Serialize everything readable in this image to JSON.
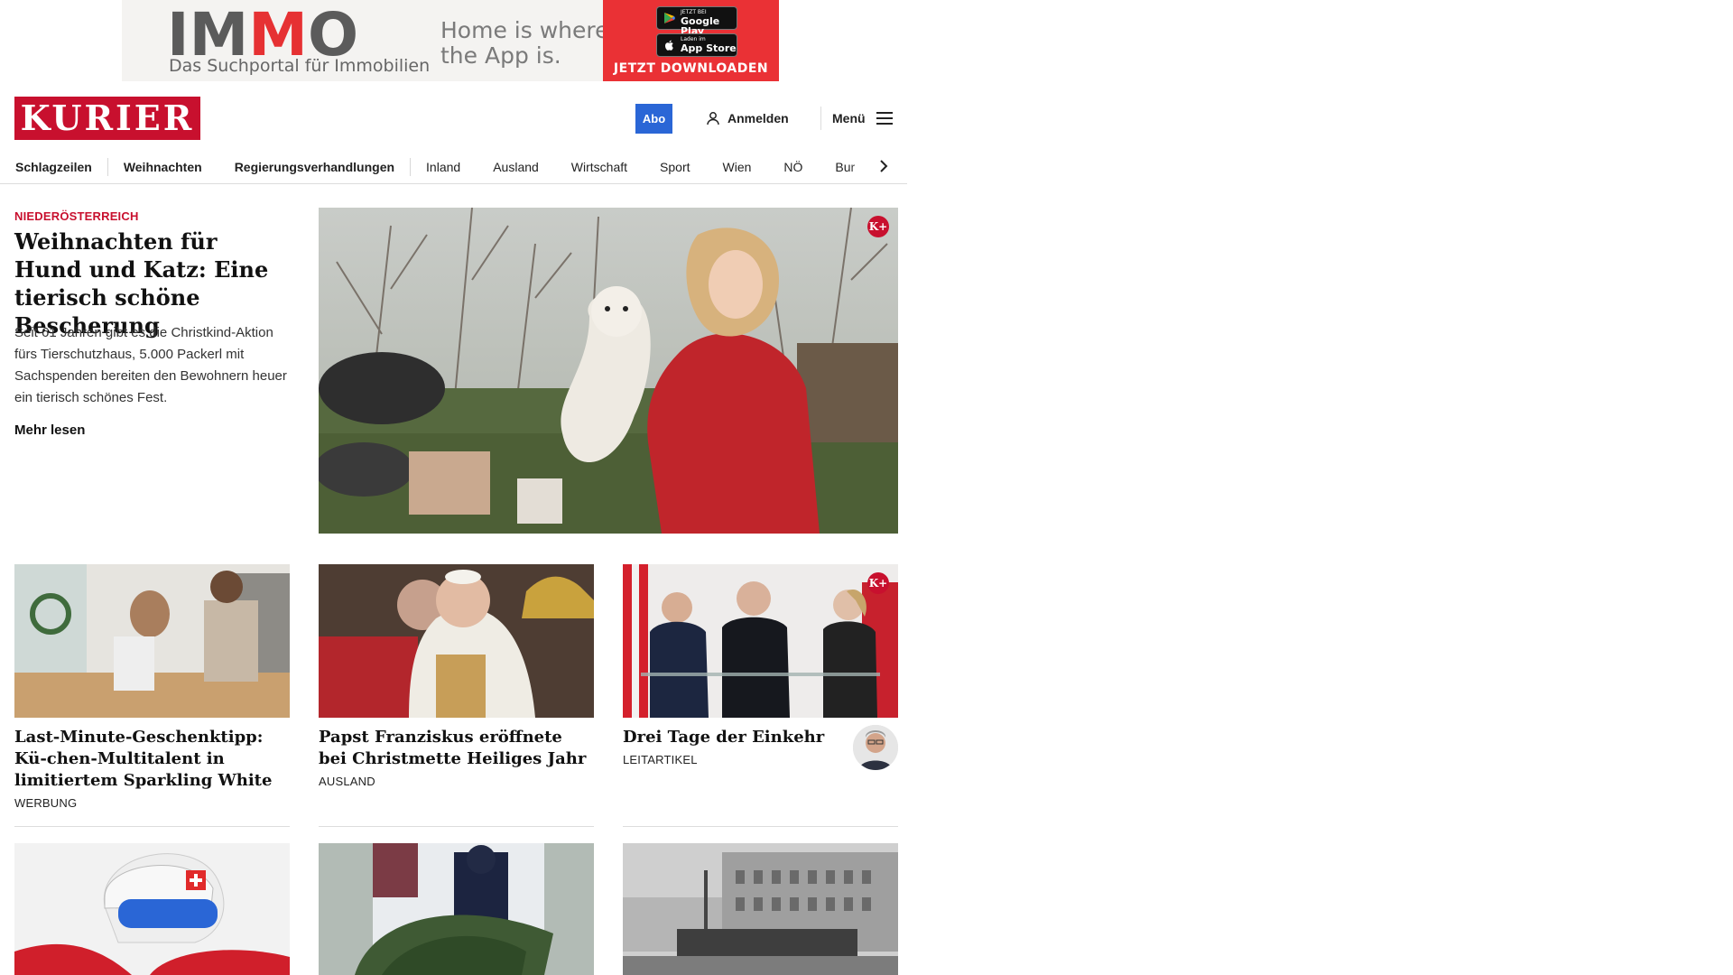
{
  "ad": {
    "brand_pre": "I",
    "brand_m1": "M",
    "brand_m2": "M",
    "brand_post": "O",
    "subline": "Das Suchportal für Immobilien",
    "slogan_line1": "Home is where",
    "slogan_line2": "the App is.",
    "google_small": "JETZT BEI",
    "google_big": "Google Play",
    "apple_small": "Laden im",
    "apple_big": "App Store",
    "cta": "JETZT DOWNLOADEN",
    "colors": {
      "brand_red": "#e63133",
      "brand_grey": "#5b5b5b"
    }
  },
  "header": {
    "logo": "KURIER",
    "abo": "Abo",
    "login": "Anmelden",
    "menu": "Menü",
    "icons": {
      "login": "user-icon",
      "menu": "hamburger-icon"
    },
    "colors": {
      "logo_bg": "#c8102e",
      "abo_bg": "#2a66d6"
    }
  },
  "nav": {
    "items": [
      "Schlagzeilen",
      "Weihnachten",
      "Regierungsverhandlungen",
      "Inland",
      "Ausland",
      "Wirtschaft",
      "Sport",
      "Wien",
      "NÖ",
      "Bur"
    ],
    "icons": {
      "scroll": "chevron-right-icon"
    }
  },
  "hero": {
    "kicker": "NIEDERÖSTERREICH",
    "title": "Weihnachten für Hund und Katz: Eine tierisch schöne Bescherung",
    "lead": "Seit 61 Jahren gibt es die Christkind-Aktion fürs Tierschutzhaus, 5.000 Packerl mit Sachspenden bereiten den Bewohnern heuer ein tierisch schönes Fest.",
    "more": "Mehr lesen",
    "badge": "K+"
  },
  "cards": [
    {
      "title": "Last-Minute-Geschenktipp: Kü-chen-Multitalent in limitiertem Sparkling White",
      "tag": "WERBUNG"
    },
    {
      "title": "Papst Franziskus eröffnete bei Christmette Heiliges Jahr",
      "tag": "AUSLAND"
    },
    {
      "title": "Drei Tage der Einkehr",
      "tag": "LEITARTIKEL",
      "badge": "K+"
    }
  ]
}
